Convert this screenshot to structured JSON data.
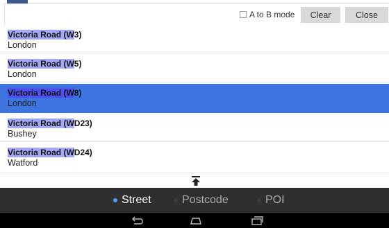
{
  "toolbar": {
    "ab_mode_label": "A to B mode",
    "ab_mode_checked": false,
    "clear_label": "Clear",
    "close_label": "Close"
  },
  "results": [
    {
      "match": "Victoria Road (W",
      "rest": "3)",
      "city": "London",
      "selected": false
    },
    {
      "match": "Victoria Road (W",
      "rest": "5)",
      "city": "London",
      "selected": false
    },
    {
      "match": "Victoria Road (W",
      "rest": "8)",
      "city": "London",
      "selected": true
    },
    {
      "match": "Victoria Road (W",
      "rest": "D23)",
      "city": "Bushey",
      "selected": false
    },
    {
      "match": "Victoria Road (W",
      "rest": "D24)",
      "city": "Watford",
      "selected": false
    }
  ],
  "search_modes": [
    {
      "label": "Street",
      "active": true
    },
    {
      "label": "Postcode",
      "active": false
    },
    {
      "label": "POI",
      "active": false
    }
  ],
  "icons": {
    "collapse": "collapse-arrow-icon",
    "back": "back-icon",
    "home": "home-icon",
    "recent": "recent-apps-icon"
  },
  "colors": {
    "selected_row": "#3d74e0",
    "match_highlight": "#a3a7f7",
    "active_mode_dot": "#4aa3ff",
    "mode_bar": "#2f2f2f"
  }
}
